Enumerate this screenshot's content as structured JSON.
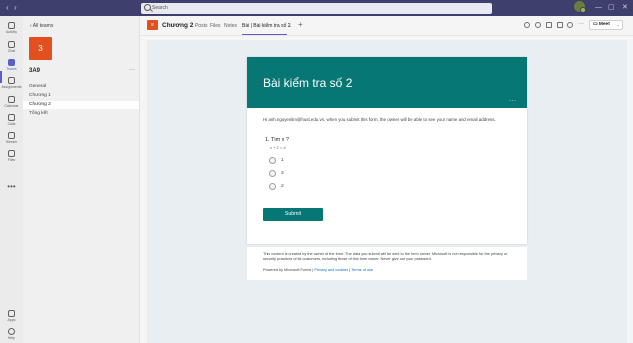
{
  "titlebar": {
    "back": "‹",
    "forward": "›",
    "search_placeholder": "Search",
    "minimize": "—",
    "maximize": "▢",
    "close": "✕"
  },
  "rail": [
    {
      "label": "Activity",
      "icon": "bell-icon"
    },
    {
      "label": "Chat",
      "icon": "chat-icon"
    },
    {
      "label": "Teams",
      "icon": "teams-icon",
      "active": true
    },
    {
      "label": "Assignments",
      "icon": "assignments-icon"
    },
    {
      "label": "Calendar",
      "icon": "calendar-icon"
    },
    {
      "label": "Calls",
      "icon": "phone-icon"
    },
    {
      "label": "Stream",
      "icon": "stream-icon"
    },
    {
      "label": "Files",
      "icon": "file-icon"
    }
  ],
  "rail_more": "•••",
  "rail_bottom": [
    {
      "label": "Apps",
      "icon": "apps-icon"
    },
    {
      "label": "Help",
      "icon": "help-icon"
    }
  ],
  "teampanel": {
    "back_label": "‹  All teams",
    "team_tile": "3",
    "team_name": "3A9",
    "team_more": "···",
    "channels": [
      "General",
      "Chương 1",
      "Chương 2",
      "Tổng kết"
    ],
    "active_channel": 2
  },
  "header": {
    "channel_icon": "≡",
    "channel_title": "Chương 2",
    "tabs": [
      "Posts",
      "Files",
      "Notes",
      "Bài | Bài kiểm tra số 2"
    ],
    "active_tab": 3,
    "tab_caret": "⌄",
    "add_tab": "+",
    "more": "···",
    "meet_label": "Meet",
    "meet_caret": "⌄"
  },
  "form": {
    "title": "Bài kiểm tra số 2",
    "banner_more": "···",
    "notice": "Hi anh.nguyenlim@hust.edu.vn, when you submit this form, the owner will be able to see your name and email address.",
    "question": "1.  Tìm x ?",
    "question_sub": "x + 2 = 4",
    "options": [
      "1",
      "3",
      "2"
    ],
    "submit_label": "Submit"
  },
  "footer": {
    "disclaimer": "This content is created by the owner of the form. The data you submit will be sent to the form owner. Microsoft is not responsible for the privacy or security practices of its customers, including those of this form owner. Never give out your password.",
    "powered_prefix": "Powered by Microsoft Forms | ",
    "privacy_link": "Privacy and cookies",
    "separator": " | ",
    "terms_link": "Terms of use"
  },
  "colors": {
    "titlebar": "#3f3f6e",
    "accent": "#5b5fc7",
    "team_tile": "#e2501f",
    "form_theme": "#077775"
  }
}
